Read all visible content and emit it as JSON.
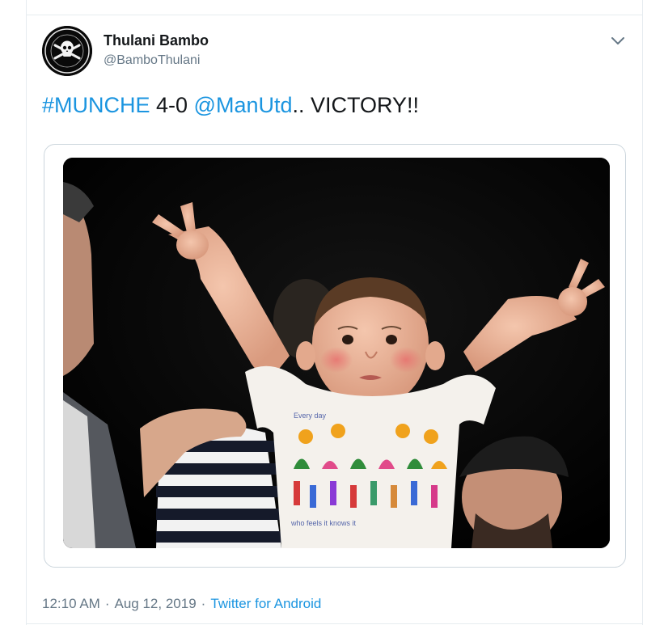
{
  "tweet": {
    "author": {
      "display_name": "Thulani Bambo",
      "handle": "@BamboThulani",
      "avatar_icon": "pirates-skull-logo"
    },
    "text_parts": [
      {
        "text": "#MUNCHE",
        "kind": "hashtag"
      },
      {
        "text": " 4-0 ",
        "kind": "plain"
      },
      {
        "text": "@ManUtd",
        "kind": "mention"
      },
      {
        "text": ".. VICTORY!!",
        "kind": "plain"
      }
    ],
    "media": {
      "kind": "photo",
      "shirt_text": "who feels it knows it",
      "shirt_text_top": "Every day"
    },
    "time": "12:10 AM",
    "date": "Aug 12, 2019",
    "separator": "·",
    "source": "Twitter for Android",
    "menu_icon": "chevron-down-icon"
  },
  "colors": {
    "link": "#1b95e0",
    "text": "#14171a",
    "secondary": "#657786",
    "border": "#e6ecf0"
  }
}
